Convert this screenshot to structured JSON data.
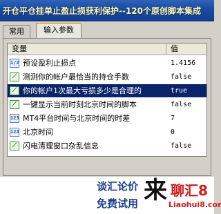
{
  "titlebar": {
    "title": "开仓平仓挂单止盈止损获利保护--120个原创脚本集成"
  },
  "tabs": [
    {
      "label": "常用"
    },
    {
      "label": "输入参数"
    }
  ],
  "list": {
    "headers": {
      "variable": "变量",
      "value": "值"
    },
    "rows": [
      {
        "icon": "double-icon",
        "glyph": "1/2",
        "name": "预设盈利止损点",
        "value": "1.4156",
        "selected": false
      },
      {
        "icon": "bool-icon",
        "glyph": "⟋",
        "name": "测测你的帐户最恰当的持仓手数",
        "value": "false",
        "selected": false
      },
      {
        "icon": "bool-icon",
        "glyph": "⟋",
        "name": "你的帐户1次最大亏损多少是合理的",
        "value": "true",
        "selected": true
      },
      {
        "icon": "bool-icon",
        "glyph": "⟋",
        "name": "一键显示当前时刻北京时间的脚本",
        "value": "false",
        "selected": false
      },
      {
        "icon": "int-icon",
        "glyph": "123",
        "name": "MT4平台时间与北京时间的时差",
        "value": "7",
        "selected": false
      },
      {
        "icon": "int-icon",
        "glyph": "123",
        "name": "北京时间",
        "value": "0",
        "selected": false
      },
      {
        "icon": "bool-icon",
        "glyph": "⟋",
        "name": "闪电清理窗口杂乱信息",
        "value": "false",
        "selected": false
      }
    ]
  },
  "footer": {
    "line1": "谈汇论价",
    "line2": "免费试用",
    "lai": "来",
    "brand": "聊汇8",
    "url": "Liaohui8.com"
  }
}
